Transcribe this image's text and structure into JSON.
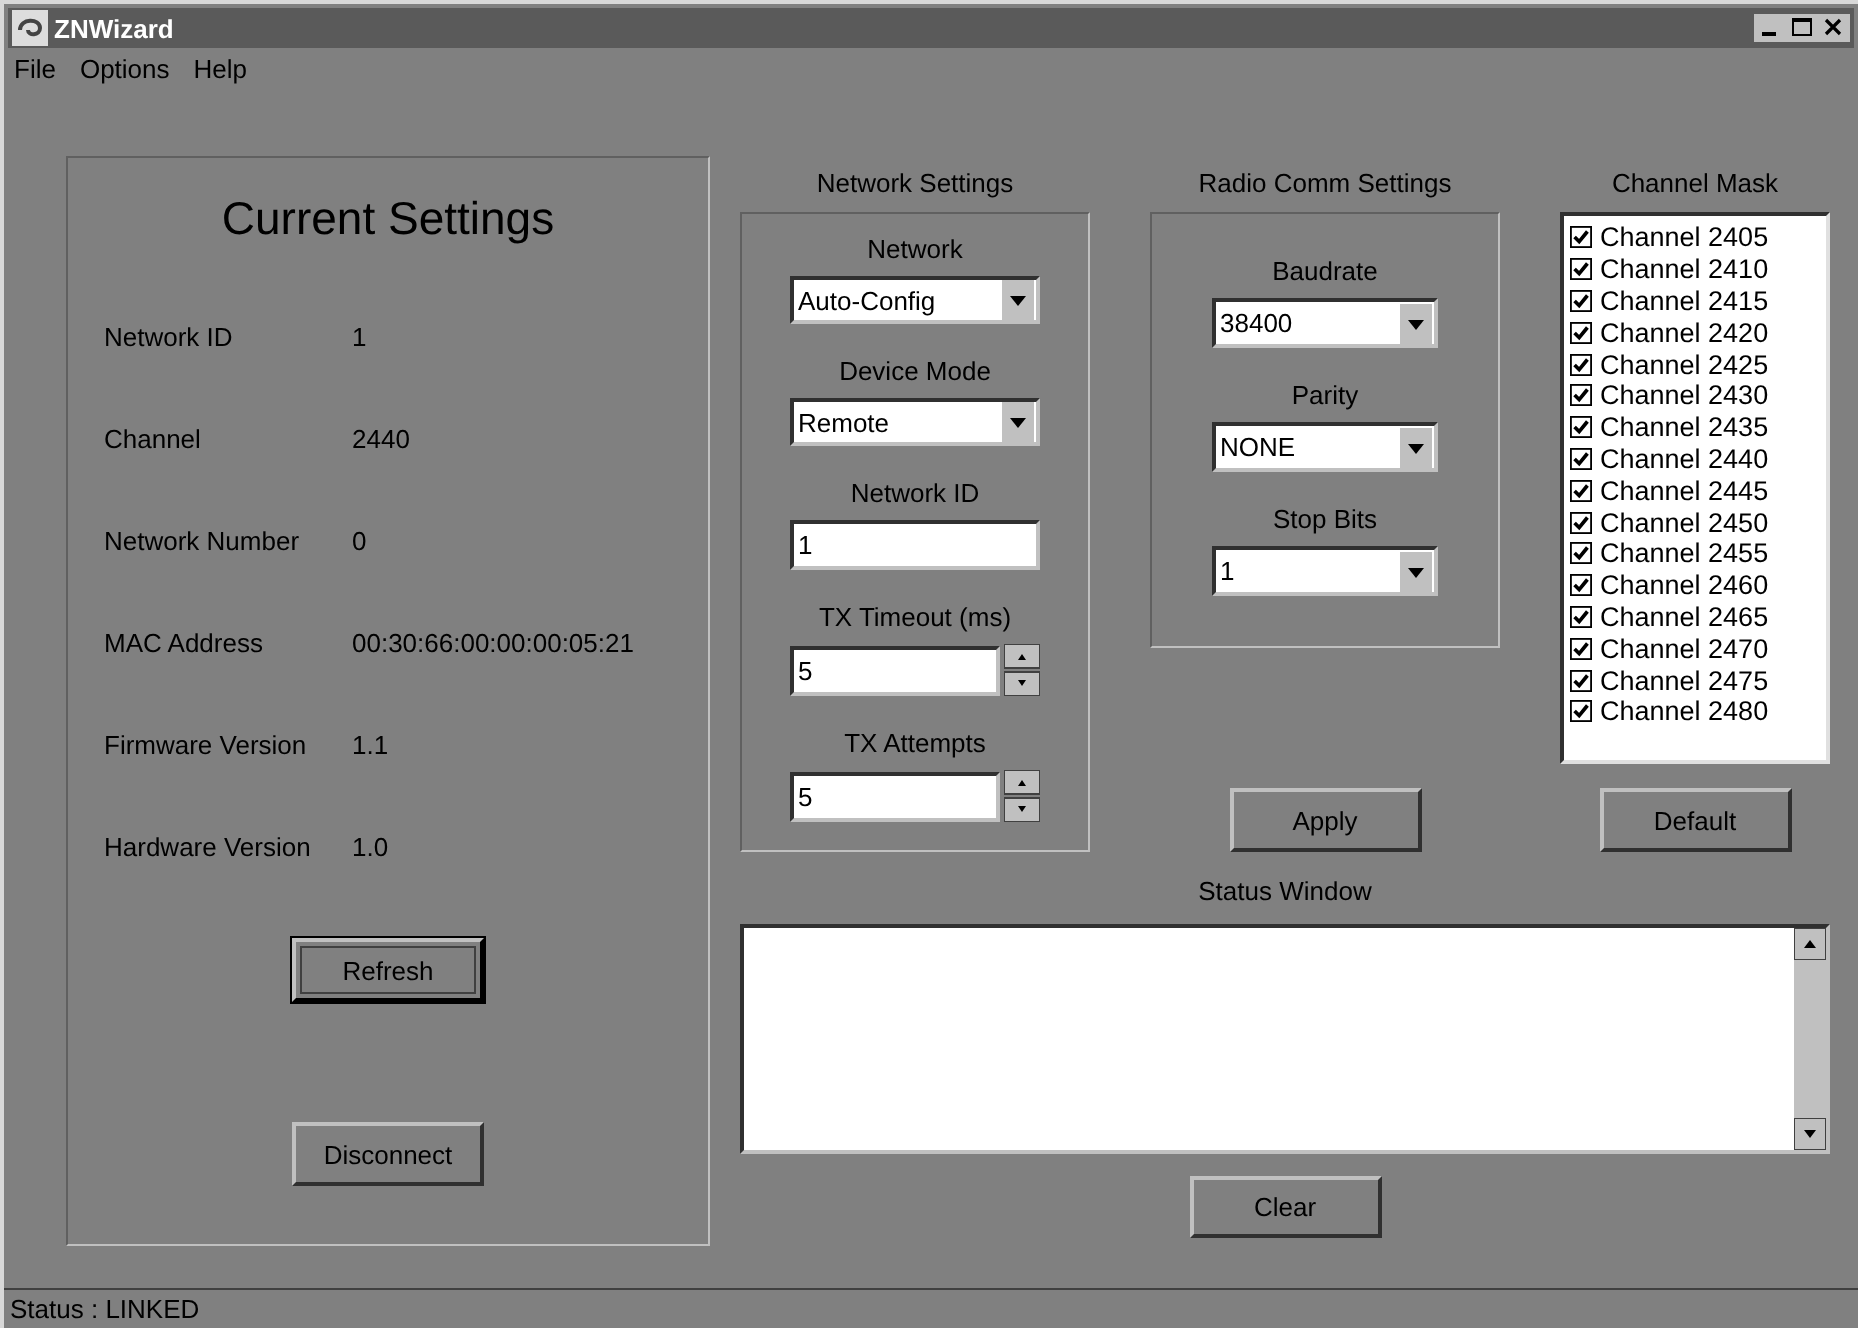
{
  "window": {
    "title": "ZNWizard"
  },
  "menu": [
    "File",
    "Options",
    "Help"
  ],
  "current_settings": {
    "title": "Current Settings",
    "rows": [
      {
        "label": "Network ID",
        "value": "1"
      },
      {
        "label": "Channel",
        "value": "2440"
      },
      {
        "label": "Network Number",
        "value": "0"
      },
      {
        "label": "MAC Address",
        "value": "00:30:66:00:00:00:05:21"
      },
      {
        "label": "Firmware Version",
        "value": "1.1"
      },
      {
        "label": "Hardware Version",
        "value": "1.0"
      }
    ],
    "buttons": [
      {
        "label": "Refresh",
        "focused": true
      },
      {
        "label": "Disconnect",
        "focused": false
      }
    ]
  },
  "network_settings": {
    "title": "Network Settings",
    "fields": [
      {
        "kind": "dropdown",
        "label": "Network",
        "value": "Auto-Config"
      },
      {
        "kind": "dropdown",
        "label": "Device Mode",
        "value": "Remote"
      },
      {
        "kind": "text",
        "label": "Network ID",
        "value": "1"
      },
      {
        "kind": "spinner",
        "label": "TX Timeout (ms)",
        "value": "5"
      },
      {
        "kind": "spinner",
        "label": "TX Attempts",
        "value": "5"
      }
    ]
  },
  "radio_comm_settings": {
    "title": "Radio Comm Settings",
    "fields": [
      {
        "kind": "dropdown",
        "label": "Baudrate",
        "value": "38400"
      },
      {
        "kind": "dropdown",
        "label": "Parity",
        "value": "NONE"
      },
      {
        "kind": "dropdown",
        "label": "Stop Bits",
        "value": "1"
      }
    ],
    "apply_button": "Apply"
  },
  "channel_mask": {
    "title": "Channel Mask",
    "channels": [
      {
        "label": "Channel 2405",
        "checked": true
      },
      {
        "label": "Channel 2410",
        "checked": true
      },
      {
        "label": "Channel 2415",
        "checked": true
      },
      {
        "label": "Channel 2420",
        "checked": true
      },
      {
        "label": "Channel 2425",
        "checked": true
      },
      {
        "label": "Channel 2430",
        "checked": true
      },
      {
        "label": "Channel 2435",
        "checked": true
      },
      {
        "label": "Channel 2440",
        "checked": true
      },
      {
        "label": "Channel 2445",
        "checked": true
      },
      {
        "label": "Channel 2450",
        "checked": true
      },
      {
        "label": "Channel 2455",
        "checked": true
      },
      {
        "label": "Channel 2460",
        "checked": true
      },
      {
        "label": "Channel 2465",
        "checked": true
      },
      {
        "label": "Channel 2470",
        "checked": true
      },
      {
        "label": "Channel 2475",
        "checked": true
      },
      {
        "label": "Channel 2480",
        "checked": true
      }
    ],
    "default_button": "Default"
  },
  "status_window": {
    "title": "Status Window",
    "clear_button": "Clear"
  },
  "status_bar": {
    "text": "Status : LINKED"
  }
}
